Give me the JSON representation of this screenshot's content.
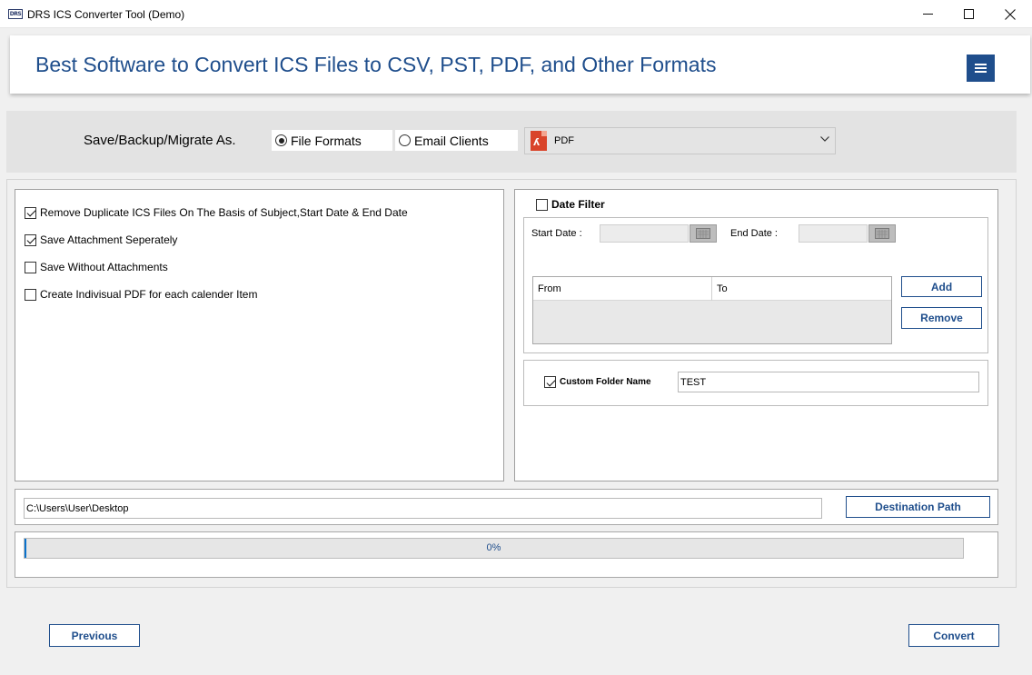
{
  "window": {
    "icon_text": "DRS",
    "title": "DRS ICS Converter Tool (Demo)",
    "minimize": "—",
    "maximize": "☐",
    "close": "✕"
  },
  "header": {
    "title": "Best Software to Convert ICS Files to CSV, PST, PDF, and Other Formats"
  },
  "save_as": {
    "label": "Save/Backup/Migrate As.",
    "options": [
      {
        "label": "File Formats",
        "checked": true
      },
      {
        "label": "Email Clients",
        "checked": false
      }
    ],
    "selected_format": "PDF",
    "format_icon": "pdf-icon"
  },
  "options": [
    {
      "label": "Remove Duplicate ICS Files On The Basis of Subject,Start Date & End Date",
      "checked": true
    },
    {
      "label": "Save Attachment Seperately",
      "checked": true
    },
    {
      "label": "Save Without Attachments",
      "checked": false
    },
    {
      "label": "Create Indivisual PDF for each calender Item",
      "checked": false
    }
  ],
  "date_filter": {
    "label": "Date Filter",
    "checked": false,
    "start_label": "Start Date :",
    "end_label": "End Date :",
    "start_value": "",
    "end_value": "",
    "columns": [
      "From",
      "To"
    ],
    "add_label": "Add",
    "remove_label": "Remove"
  },
  "custom_folder": {
    "label": "Custom Folder Name",
    "checked": true,
    "value": "TEST"
  },
  "destination": {
    "path": "C:\\Users\\User\\Desktop",
    "button_label": "Destination Path"
  },
  "progress": {
    "percent": 0,
    "text": "0%"
  },
  "footer": {
    "previous_label": "Previous",
    "convert_label": "Convert"
  },
  "colors": {
    "accent": "#1f4e8c",
    "progress": "#0a72cc",
    "pdf": "#d9442a"
  }
}
